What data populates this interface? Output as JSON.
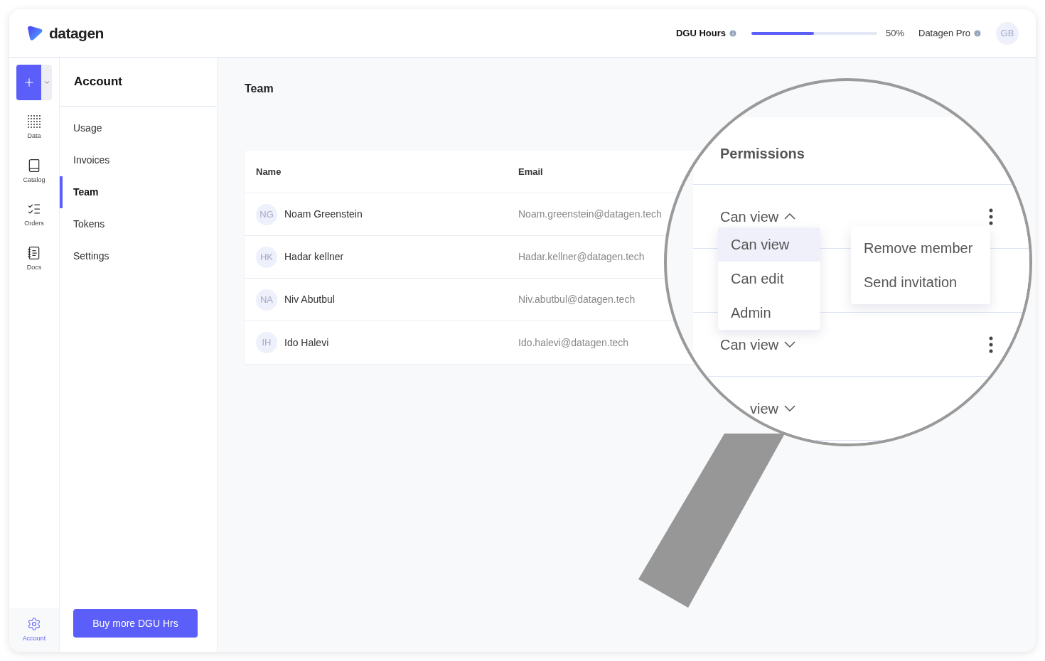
{
  "header": {
    "logo": "datagen",
    "usage": {
      "label": "DGU Hours",
      "level": 0.5,
      "reading": "50%"
    },
    "plan": "Datagen Pro",
    "avatar": "GB"
  },
  "rail": {
    "items": [
      {
        "label": "Data",
        "selected": false
      },
      {
        "label": "Catalog",
        "selected": false
      },
      {
        "label": "Orders",
        "selected": false
      },
      {
        "label": "Docs",
        "selected": false
      }
    ],
    "footer": {
      "label": "Account",
      "selected": true
    }
  },
  "sidebar": {
    "title": "Account",
    "items": [
      {
        "label": "Usage",
        "selected": false
      },
      {
        "label": "Invoices",
        "selected": false
      },
      {
        "label": "Team",
        "selected": true
      },
      {
        "label": "Tokens",
        "selected": false
      },
      {
        "label": "Settings",
        "selected": false
      }
    ],
    "button": "Buy more DGU Hrs"
  },
  "page": {
    "title": "Team"
  },
  "table": {
    "columns": [
      "Name",
      "Email"
    ],
    "rows": [
      {
        "initials": "NG",
        "name": "Noam Greenstein",
        "email": "Noam.greenstein@datagen.tech"
      },
      {
        "initials": "HK",
        "name": "Hadar kellner",
        "email": "Hadar.kellner@datagen.tech"
      },
      {
        "initials": "NA",
        "name": "Niv Abutbul",
        "email": "Niv.abutbul@datagen.tech"
      },
      {
        "initials": "IH",
        "name": "Ido Halevi",
        "email": "Ido.halevi@datagen.tech"
      }
    ]
  },
  "magnifier": {
    "header": "Permissions",
    "rows": [
      {
        "permission": "Can view",
        "expanded": true
      },
      {
        "permission": "Can view",
        "expanded": false
      },
      {
        "permission": "view",
        "expanded": false
      }
    ],
    "dropdown": [
      {
        "label": "Can view",
        "selected": true
      },
      {
        "label": "Can edit",
        "selected": false
      },
      {
        "label": "Admin",
        "selected": false
      }
    ],
    "menu": [
      "Remove member",
      "Send invitation"
    ]
  }
}
